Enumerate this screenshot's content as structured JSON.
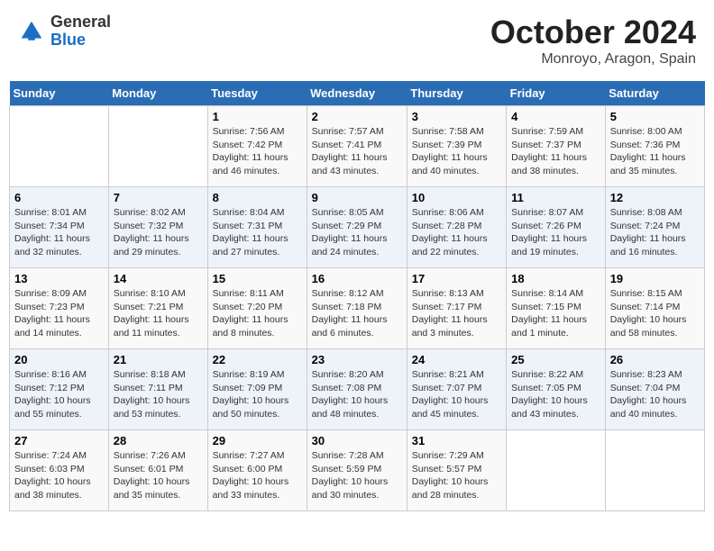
{
  "header": {
    "logo": {
      "general": "General",
      "blue": "Blue"
    },
    "month": "October 2024",
    "location": "Monroyo, Aragon, Spain"
  },
  "weekdays": [
    "Sunday",
    "Monday",
    "Tuesday",
    "Wednesday",
    "Thursday",
    "Friday",
    "Saturday"
  ],
  "weeks": [
    [
      {
        "day": "",
        "info": ""
      },
      {
        "day": "",
        "info": ""
      },
      {
        "day": "1",
        "info": "Sunrise: 7:56 AM\nSunset: 7:42 PM\nDaylight: 11 hours and 46 minutes."
      },
      {
        "day": "2",
        "info": "Sunrise: 7:57 AM\nSunset: 7:41 PM\nDaylight: 11 hours and 43 minutes."
      },
      {
        "day": "3",
        "info": "Sunrise: 7:58 AM\nSunset: 7:39 PM\nDaylight: 11 hours and 40 minutes."
      },
      {
        "day": "4",
        "info": "Sunrise: 7:59 AM\nSunset: 7:37 PM\nDaylight: 11 hours and 38 minutes."
      },
      {
        "day": "5",
        "info": "Sunrise: 8:00 AM\nSunset: 7:36 PM\nDaylight: 11 hours and 35 minutes."
      }
    ],
    [
      {
        "day": "6",
        "info": "Sunrise: 8:01 AM\nSunset: 7:34 PM\nDaylight: 11 hours and 32 minutes."
      },
      {
        "day": "7",
        "info": "Sunrise: 8:02 AM\nSunset: 7:32 PM\nDaylight: 11 hours and 29 minutes."
      },
      {
        "day": "8",
        "info": "Sunrise: 8:04 AM\nSunset: 7:31 PM\nDaylight: 11 hours and 27 minutes."
      },
      {
        "day": "9",
        "info": "Sunrise: 8:05 AM\nSunset: 7:29 PM\nDaylight: 11 hours and 24 minutes."
      },
      {
        "day": "10",
        "info": "Sunrise: 8:06 AM\nSunset: 7:28 PM\nDaylight: 11 hours and 22 minutes."
      },
      {
        "day": "11",
        "info": "Sunrise: 8:07 AM\nSunset: 7:26 PM\nDaylight: 11 hours and 19 minutes."
      },
      {
        "day": "12",
        "info": "Sunrise: 8:08 AM\nSunset: 7:24 PM\nDaylight: 11 hours and 16 minutes."
      }
    ],
    [
      {
        "day": "13",
        "info": "Sunrise: 8:09 AM\nSunset: 7:23 PM\nDaylight: 11 hours and 14 minutes."
      },
      {
        "day": "14",
        "info": "Sunrise: 8:10 AM\nSunset: 7:21 PM\nDaylight: 11 hours and 11 minutes."
      },
      {
        "day": "15",
        "info": "Sunrise: 8:11 AM\nSunset: 7:20 PM\nDaylight: 11 hours and 8 minutes."
      },
      {
        "day": "16",
        "info": "Sunrise: 8:12 AM\nSunset: 7:18 PM\nDaylight: 11 hours and 6 minutes."
      },
      {
        "day": "17",
        "info": "Sunrise: 8:13 AM\nSunset: 7:17 PM\nDaylight: 11 hours and 3 minutes."
      },
      {
        "day": "18",
        "info": "Sunrise: 8:14 AM\nSunset: 7:15 PM\nDaylight: 11 hours and 1 minute."
      },
      {
        "day": "19",
        "info": "Sunrise: 8:15 AM\nSunset: 7:14 PM\nDaylight: 10 hours and 58 minutes."
      }
    ],
    [
      {
        "day": "20",
        "info": "Sunrise: 8:16 AM\nSunset: 7:12 PM\nDaylight: 10 hours and 55 minutes."
      },
      {
        "day": "21",
        "info": "Sunrise: 8:18 AM\nSunset: 7:11 PM\nDaylight: 10 hours and 53 minutes."
      },
      {
        "day": "22",
        "info": "Sunrise: 8:19 AM\nSunset: 7:09 PM\nDaylight: 10 hours and 50 minutes."
      },
      {
        "day": "23",
        "info": "Sunrise: 8:20 AM\nSunset: 7:08 PM\nDaylight: 10 hours and 48 minutes."
      },
      {
        "day": "24",
        "info": "Sunrise: 8:21 AM\nSunset: 7:07 PM\nDaylight: 10 hours and 45 minutes."
      },
      {
        "day": "25",
        "info": "Sunrise: 8:22 AM\nSunset: 7:05 PM\nDaylight: 10 hours and 43 minutes."
      },
      {
        "day": "26",
        "info": "Sunrise: 8:23 AM\nSunset: 7:04 PM\nDaylight: 10 hours and 40 minutes."
      }
    ],
    [
      {
        "day": "27",
        "info": "Sunrise: 7:24 AM\nSunset: 6:03 PM\nDaylight: 10 hours and 38 minutes."
      },
      {
        "day": "28",
        "info": "Sunrise: 7:26 AM\nSunset: 6:01 PM\nDaylight: 10 hours and 35 minutes."
      },
      {
        "day": "29",
        "info": "Sunrise: 7:27 AM\nSunset: 6:00 PM\nDaylight: 10 hours and 33 minutes."
      },
      {
        "day": "30",
        "info": "Sunrise: 7:28 AM\nSunset: 5:59 PM\nDaylight: 10 hours and 30 minutes."
      },
      {
        "day": "31",
        "info": "Sunrise: 7:29 AM\nSunset: 5:57 PM\nDaylight: 10 hours and 28 minutes."
      },
      {
        "day": "",
        "info": ""
      },
      {
        "day": "",
        "info": ""
      }
    ]
  ]
}
